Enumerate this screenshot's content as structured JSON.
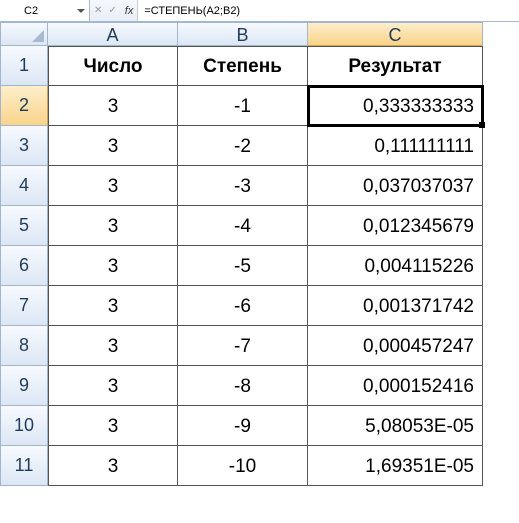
{
  "name_box": "C2",
  "fx_label": "fx",
  "formula": "=СТЕПЕНЬ(A2;B2)",
  "columns": [
    "A",
    "B",
    "C"
  ],
  "headers": {
    "a": "Число",
    "b": "Степень",
    "c": "Результат"
  },
  "selected_cell": "C2",
  "rows": [
    {
      "n": "1"
    },
    {
      "n": "2",
      "a": "3",
      "b": "-1",
      "c": "0,333333333"
    },
    {
      "n": "3",
      "a": "3",
      "b": "-2",
      "c": "0,111111111"
    },
    {
      "n": "4",
      "a": "3",
      "b": "-3",
      "c": "0,037037037"
    },
    {
      "n": "5",
      "a": "3",
      "b": "-4",
      "c": "0,012345679"
    },
    {
      "n": "6",
      "a": "3",
      "b": "-5",
      "c": "0,004115226"
    },
    {
      "n": "7",
      "a": "3",
      "b": "-6",
      "c": "0,001371742"
    },
    {
      "n": "8",
      "a": "3",
      "b": "-7",
      "c": "0,000457247"
    },
    {
      "n": "9",
      "a": "3",
      "b": "-8",
      "c": "0,000152416"
    },
    {
      "n": "10",
      "a": "3",
      "b": "-9",
      "c": "5,08053E-05"
    },
    {
      "n": "11",
      "a": "3",
      "b": "-10",
      "c": "1,69351E-05"
    }
  ],
  "chart_data": {
    "type": "table",
    "title": "СТЕПЕНЬ (POWER) worksheet",
    "columns": [
      "Число",
      "Степень",
      "Результат"
    ],
    "data": [
      [
        3,
        -1,
        "0,333333333"
      ],
      [
        3,
        -2,
        "0,111111111"
      ],
      [
        3,
        -3,
        "0,037037037"
      ],
      [
        3,
        -4,
        "0,012345679"
      ],
      [
        3,
        -5,
        "0,004115226"
      ],
      [
        3,
        -6,
        "0,001371742"
      ],
      [
        3,
        -7,
        "0,000457247"
      ],
      [
        3,
        -8,
        "0,000152416"
      ],
      [
        3,
        -9,
        "5,08053E-05"
      ],
      [
        3,
        -10,
        "1,69351E-05"
      ]
    ]
  }
}
